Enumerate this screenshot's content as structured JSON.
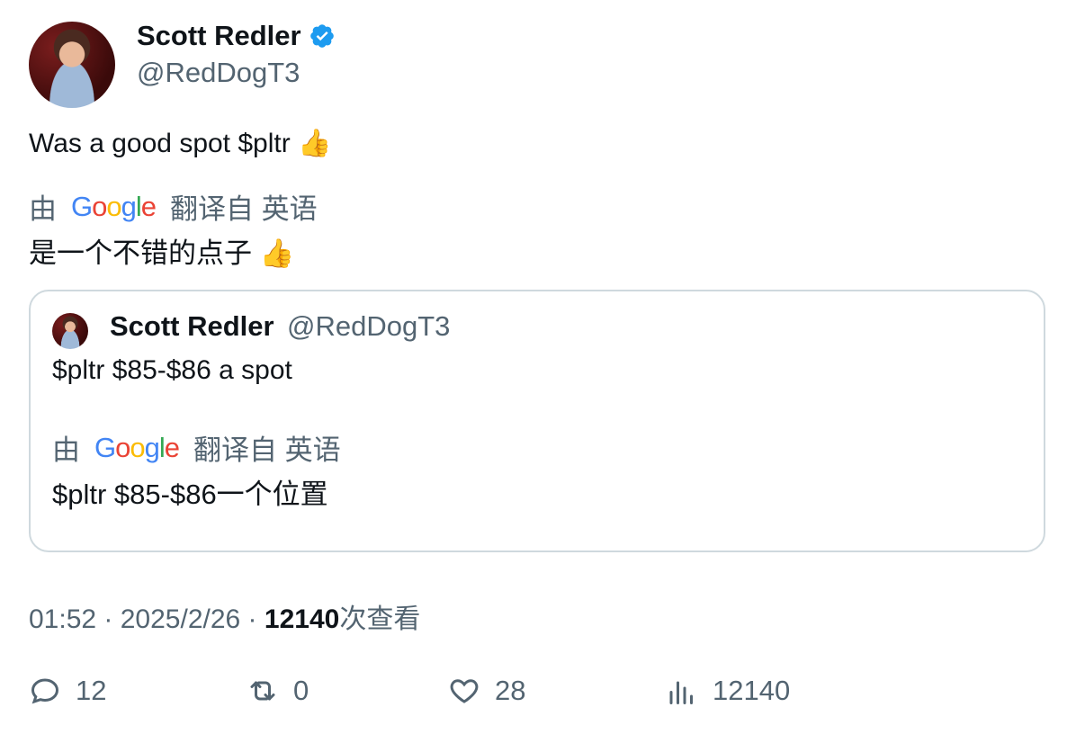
{
  "author": {
    "name": "Scott Redler",
    "handle": "@RedDogT3"
  },
  "tweet": {
    "text": "Was a good spot $pltr 👍",
    "translate_prefix": "由",
    "translate_suffix": "翻译自 英语",
    "translated_text": "是一个不错的点子 👍"
  },
  "quote": {
    "name": "Scott Redler",
    "handle": "@RedDogT3",
    "text": "$pltr $85-$86 a spot",
    "translate_prefix": "由",
    "translate_suffix": "翻译自 英语",
    "translated_text": "$pltr $85-$86一个位置"
  },
  "google_letters": [
    "G",
    "o",
    "o",
    "g",
    "l",
    "e"
  ],
  "meta": {
    "time": "01:52",
    "sep1": " · ",
    "date": "2025/2/26",
    "sep2": " · ",
    "views_count": "12140",
    "views_label": "次查看"
  },
  "actions": {
    "replies": "12",
    "retweets": "0",
    "likes": "28",
    "views": "12140"
  },
  "icons": {
    "verified": "verified-badge-icon",
    "reply": "reply-icon",
    "retweet": "retweet-icon",
    "like": "heart-icon",
    "views": "analytics-icon"
  },
  "colors": {
    "verified": "#1d9bf0",
    "secondary_text": "#536471",
    "border": "#cfd9de"
  }
}
